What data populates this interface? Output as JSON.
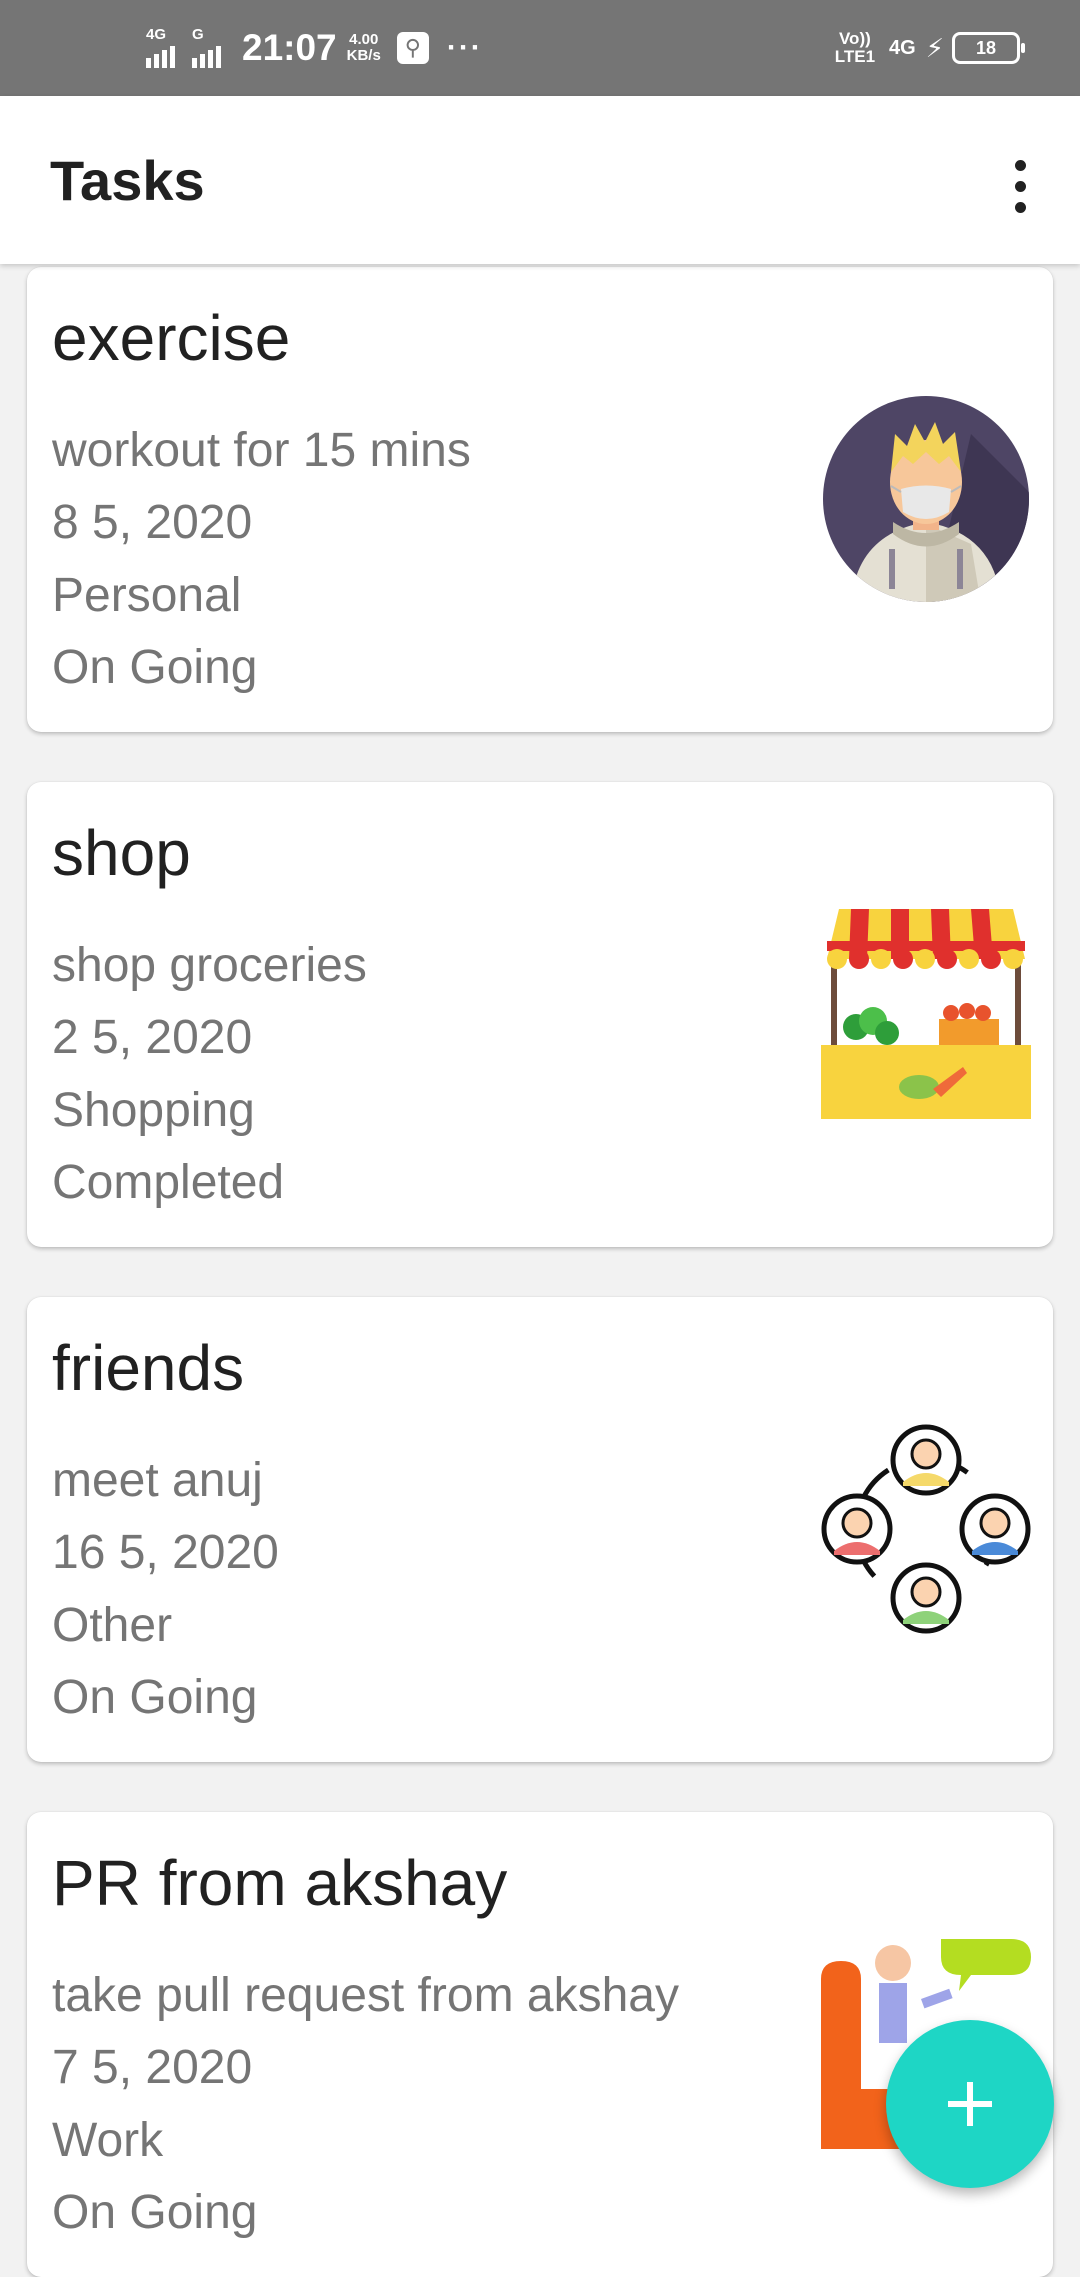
{
  "status_bar": {
    "sim1_label": "4G",
    "sim2_label": "G",
    "time": "21:07",
    "speed_value": "4.00",
    "speed_unit": "KB/s",
    "more": "···",
    "volte_top": "Vo))",
    "volte_bottom": "LTE1",
    "network": "4G",
    "battery": "18"
  },
  "app_bar": {
    "title": "Tasks",
    "overflow_icon": "more-vert-icon"
  },
  "tasks": [
    {
      "title": "exercise",
      "description": "workout for 15 mins",
      "date": "8 5, 2020",
      "category": "Personal",
      "status": "On Going",
      "image": "masked-person-avatar"
    },
    {
      "title": "shop",
      "description": "shop groceries",
      "date": "2 5, 2020",
      "category": "Shopping",
      "status": "Completed",
      "image": "market-stall"
    },
    {
      "title": "friends",
      "description": "meet anuj",
      "date": "16 5, 2020",
      "category": "Other",
      "status": "On Going",
      "image": "friends-circle"
    },
    {
      "title": "PR from akshay",
      "description": "take pull request from akshay",
      "date": "7 5, 2020",
      "category": "Work",
      "status": "On Going",
      "image": "conversation-chair"
    }
  ],
  "fab": {
    "icon": "plus-icon",
    "color": "#1ed6c5"
  },
  "colors": {
    "status_bar": "#757575",
    "primary_text": "#212121",
    "secondary_text": "#757575",
    "background": "#f2f2f2"
  }
}
